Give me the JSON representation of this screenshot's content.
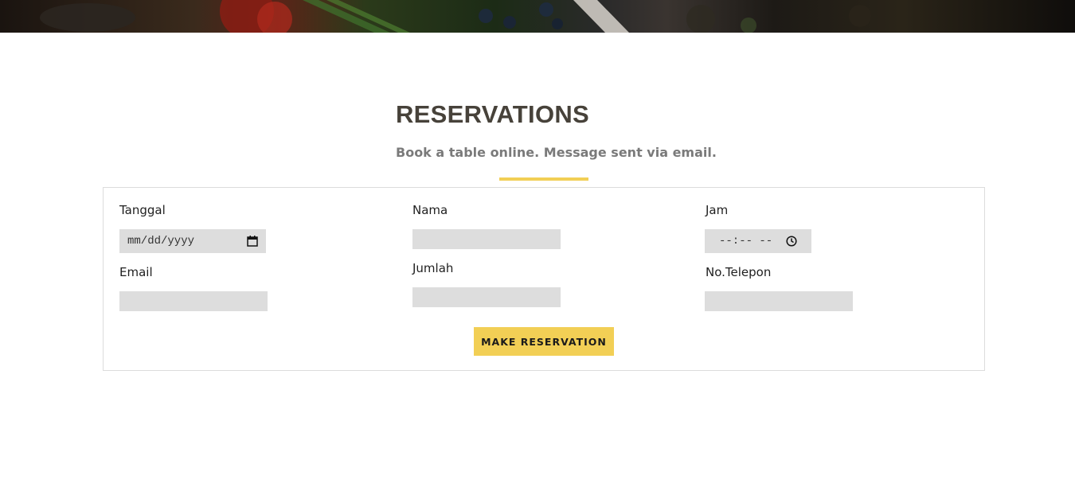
{
  "section": {
    "title": "RESERVATIONS",
    "subtitle": "Book a table online. Message sent via email."
  },
  "form": {
    "tanggal": {
      "label": "Tanggal",
      "value": "mm/dd/yyyy",
      "icon": "calendar-icon"
    },
    "nama": {
      "label": "Nama",
      "value": ""
    },
    "jam": {
      "label": "Jam",
      "value": "--:-- --",
      "icon": "clock-icon"
    },
    "email": {
      "label": "Email",
      "value": ""
    },
    "jumlah": {
      "label": "Jumlah",
      "value": ""
    },
    "telepon": {
      "label": "No.Telepon",
      "value": ""
    },
    "submit_label": "MAKE RESERVATION"
  },
  "colors": {
    "accent": "#f2cf55",
    "title": "#47423a",
    "subtitle": "#7a7a7a",
    "input_bg": "#dddddd"
  }
}
